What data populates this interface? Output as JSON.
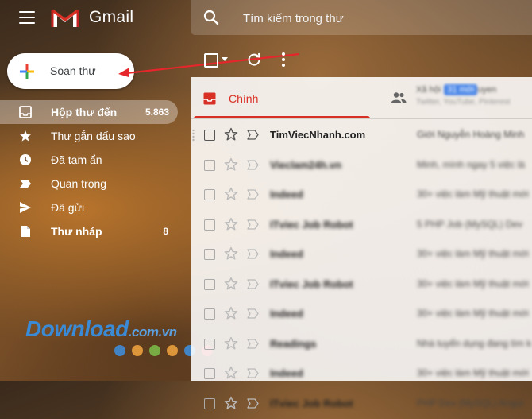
{
  "header": {
    "app_name": "Gmail",
    "search_placeholder": "Tìm kiếm trong thư"
  },
  "compose": {
    "label": "Soạn thư"
  },
  "nav": [
    {
      "label": "Hộp thư đến",
      "count": "5.863",
      "icon": "inbox-icon",
      "active": true
    },
    {
      "label": "Thư gắn dấu sao",
      "count": "",
      "icon": "star-icon"
    },
    {
      "label": "Đã tạm ẩn",
      "count": "",
      "icon": "clock-icon"
    },
    {
      "label": "Quan trọng",
      "count": "",
      "icon": "important-icon"
    },
    {
      "label": "Đã gửi",
      "count": "",
      "icon": "send-icon"
    },
    {
      "label": "Thư nháp",
      "count": "8",
      "icon": "draft-icon"
    }
  ],
  "tabs": {
    "primary": "Chính",
    "social_line1": "Xã hội",
    "social_chip": "31 mới",
    "social_line2": "Twitter, YouTube, Pinterest",
    "social_suffix": "uyen"
  },
  "emails": [
    {
      "sender": "TimViecNhanh.com",
      "snippet": "Giới Nguyễn Hoàng Minh"
    },
    {
      "sender": "Vieclam24h.vn",
      "snippet": "Minh, mình ngay 5 việc là"
    },
    {
      "sender": "Indeed",
      "snippet": "30+ việc làm Mỹ thuật mới"
    },
    {
      "sender": "ITviec Job Robot",
      "snippet": "5 PHP Job (MySQL) Dev"
    },
    {
      "sender": "Indeed",
      "snippet": "30+ việc làm Mỹ thuật mới"
    },
    {
      "sender": "ITviec Job Robot",
      "snippet": "30+ việc làm Mỹ thuật mới"
    },
    {
      "sender": "Indeed",
      "snippet": "30+ việc làm Mỹ thuật mới"
    },
    {
      "sender": "Readings",
      "snippet": "Nhà tuyển dụng đang tìm kiếm"
    },
    {
      "sender": "Indeed",
      "snippet": "30+ việc làm Mỹ thuật mới"
    },
    {
      "sender": "ITviec Job Robot",
      "snippet": "PHP Dev (MySQL) Angul"
    }
  ],
  "watermark": {
    "main": "Download",
    "suffix": ".com.vn"
  },
  "colors": {
    "accent_red": "#d93025",
    "watermark_blue": "#3a8ad6",
    "dots": [
      "#3d8fe0",
      "#f3a640",
      "#7cc04b",
      "#f3a640",
      "#3d8fe0",
      "#e8444a"
    ]
  }
}
